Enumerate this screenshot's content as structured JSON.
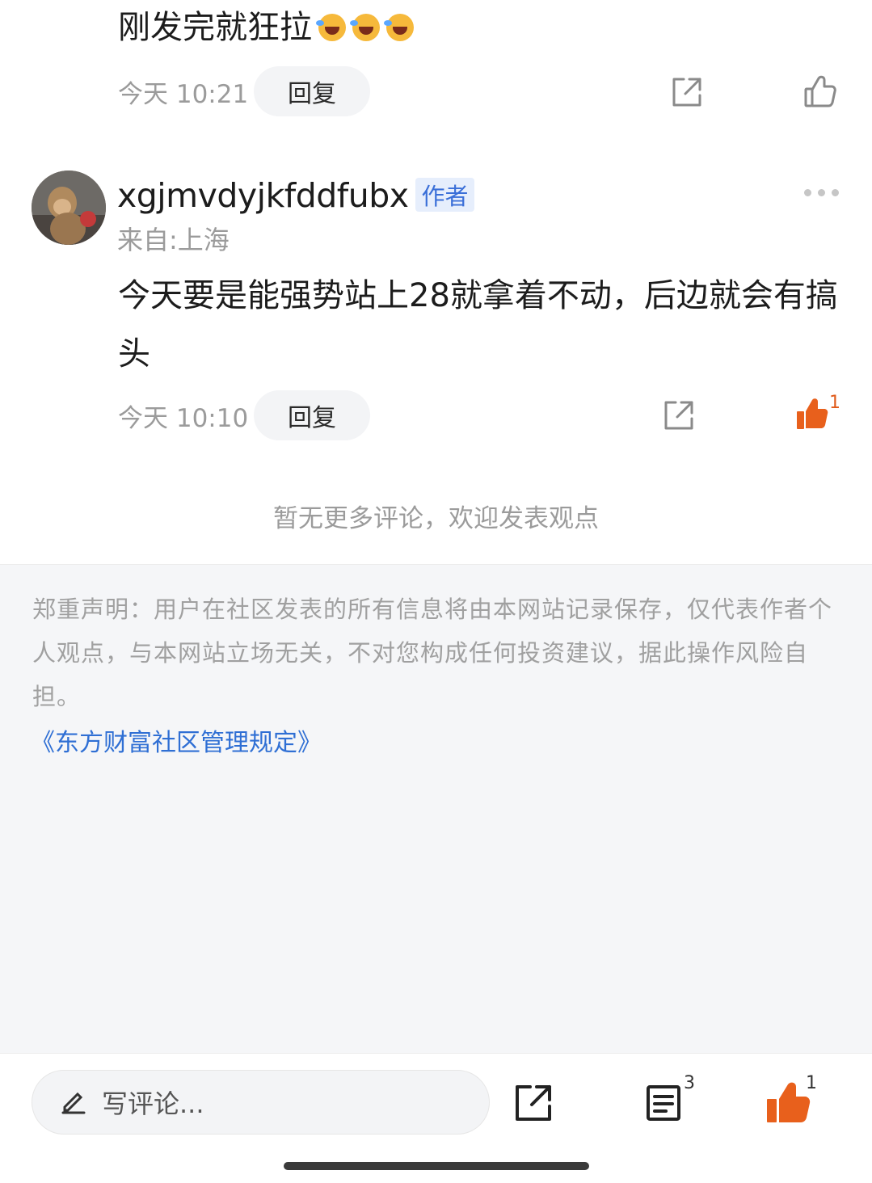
{
  "comment_prev": {
    "text": "刚发完就狂拉",
    "emoji": [
      "laughing-crying-emoji",
      "laughing-crying-emoji",
      "laughing-crying-emoji"
    ],
    "time": "今天 10:21",
    "reply_label": "回复"
  },
  "comment_main": {
    "username": "xgjmvdyjkfddfubx",
    "badge": "作者",
    "location": "来自:上海",
    "text": "今天要是能强势站上28就拿着不动，后边就会有搞头",
    "time": "今天 10:10",
    "reply_label": "回复",
    "like_count": "1"
  },
  "no_more_text": "暂无更多评论，欢迎发表观点",
  "disclaimer": {
    "text": "郑重声明：用户在社区发表的所有信息将由本网站记录保存，仅代表作者个人观点，与本网站立场无关，不对您构成任何投资建议，据此操作风险自担。",
    "link": "《东方财富社区管理规定》"
  },
  "bottom_bar": {
    "input_placeholder": "写评论...",
    "comment_count": "3",
    "like_count": "1"
  },
  "colors": {
    "accent_orange": "#e8601c",
    "link_blue": "#2f6fd4",
    "muted_gray": "#9b9b9b"
  }
}
